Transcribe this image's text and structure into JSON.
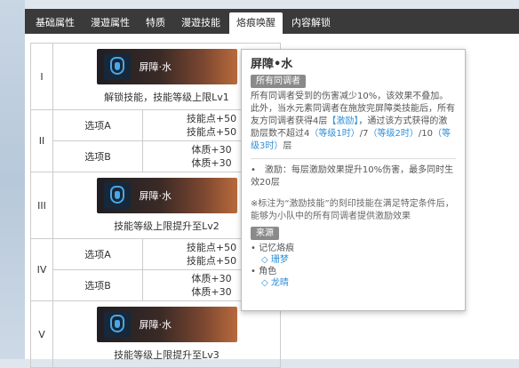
{
  "tabs": [
    "基础属性",
    "漫遊属性",
    "特质",
    "漫遊技能",
    "烙痕唤醒",
    "内容解锁"
  ],
  "active_tab": 4,
  "rows": [
    {
      "level": "I",
      "banner": "屏障·水",
      "caption": "解锁技能，技能等级上限Lv1"
    },
    {
      "level": "II",
      "options": [
        {
          "label": "选项A",
          "values": [
            "技能点+50",
            "技能点+50"
          ]
        },
        {
          "label": "选项B",
          "values": [
            "体质+30",
            "体质+30"
          ]
        }
      ]
    },
    {
      "level": "III",
      "banner": "屏障·水",
      "caption": "技能等级上限提升至Lv2"
    },
    {
      "level": "IV",
      "options": [
        {
          "label": "选项A",
          "values": [
            "技能点+50",
            "技能点+50"
          ]
        },
        {
          "label": "选项B",
          "values": [
            "体质+30",
            "体质+30"
          ]
        }
      ]
    },
    {
      "level": "V",
      "banner": "屏障·水",
      "caption": "技能等级上限提升至Lv3"
    }
  ],
  "tooltip": {
    "title": "屏障•水",
    "chip": "所有同调者",
    "desc1": "所有同调者受到的伤害减少10%，该效果不叠加。",
    "desc2a": "此外，当水元素同调者在施放完屏障类技能后，所有友方同调者获得4层",
    "desc2_link": "【激励】",
    "desc2b": "，通过该方式获得的激励层数不超过",
    "n1": "4",
    "n1_note": "（等级1时）",
    "slash1": "/",
    "n2": "7",
    "n2_note": "（等级2时）",
    "slash2": "/",
    "n3": "10",
    "n3_note": "（等级3时）",
    "tail": "层",
    "bullet": "•　激励：每层激励效果提升10%伤害，最多同时生效20层",
    "note": "※标注为“激励技能”的刻印技能在满足特定条件后，能够为小队中的所有同调者提供激励效果",
    "source_chip": "来源",
    "src1": "• 记忆烙痕",
    "src1_item": "◇ 珊梦",
    "src2": "• 角色",
    "src2_item": "◇ 龙晴"
  },
  "colors": {
    "tab_bg": "#3a3a3a",
    "accent": "#2f8fd8",
    "chip": "#8a8a8a"
  }
}
